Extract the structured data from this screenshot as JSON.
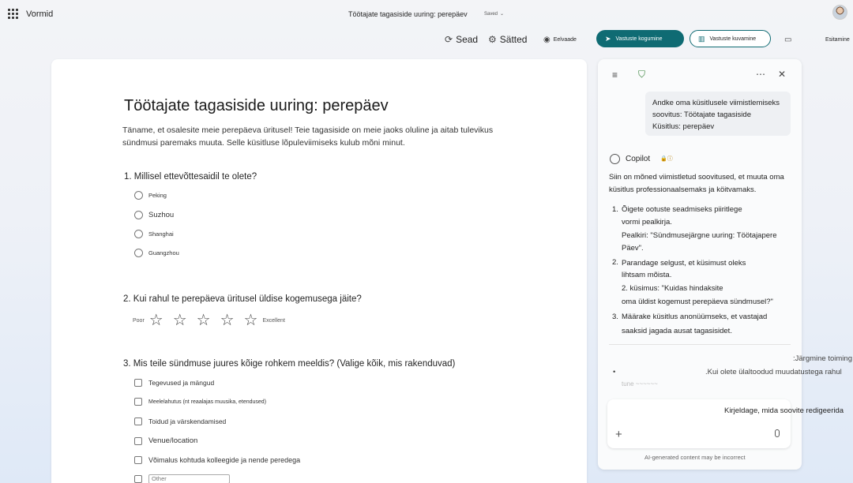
{
  "header": {
    "app_name": "Vormid",
    "doc_title": "Töötajate tagasiside uuring: perepäev",
    "saved_label": "Saved"
  },
  "toolbar": {
    "devices": "Sead",
    "settings": "Sätted",
    "preview": "Eelvaade",
    "collect": "Vastuste kogumine",
    "view_responses": "Vastuste kuvamine",
    "present": "Esitamine"
  },
  "form": {
    "title": "Töötajate tagasiside uuring: perepäev",
    "description": "Täname, et osalesite meie perepäeva üritusel! Teie tagasiside on meie jaoks oluline ja aitab tulevikus sündmusi paremaks muuta. Selle küsitluse lõpuleviimiseks kulub mõni minut.",
    "q1": {
      "label": "1. Millisel ettevõttesaidil te olete?",
      "options": [
        "Peking",
        "Suzhou",
        "Shanghai",
        "Guangzhou"
      ]
    },
    "q2": {
      "number": "2.",
      "label": "Kui rahul te perepäeva üritusel üldise kogemusega jäite?",
      "low": "Poor",
      "high": "Excellent",
      "stars": 5
    },
    "q3": {
      "number": "3.",
      "label": "Mis teile sündmuse juures kõige rohkem meeldis? (Valige kõik, mis rakenduvad)",
      "options": [
        "Tegevused ja mängud",
        "Meelelahutus (nt reaalajas muusika, etendused)",
        "Toidud ja värskendamised",
        "Venue/location",
        "Võimalus kohtuda kolleegide ja nende peredega"
      ],
      "other_placeholder": "Other"
    }
  },
  "copilot": {
    "user_message": [
      "Andke oma küsitlusele viimistlemiseks",
      "soovitus: Töötajate tagasiside",
      "Küsitlus: perepäev"
    ],
    "name": "Copilot",
    "intro": "Siin on mõned viimistletud soovitused, et muuta oma küsitlus professionaalsemaks ja köitvamaks.",
    "items": {
      "n1": "1.",
      "i1_line1": "Õigete ootuste seadmiseks piiritlege",
      "i1_line2": "vormi pealkirja.",
      "i1_line3": "Pealkiri: \"Sündmusejärgne uuring: Töötajapere",
      "i1_line4": "Päev\".",
      "n2": "2.",
      "i2_line1": "Parandage selgust, et küsimust oleks",
      "i2_line2": "lihtsam mõista.",
      "i2_line3": "2. küsimus: \"Kuidas hindaksite",
      "i2_line4": "oma üldist kogemust perepäeva sündmusel?\"",
      "n3": "3.",
      "i3_line1": "Määrake küsitlus anonüümseks, et vastajad",
      "i3_line2": "saaksid jagada ausat tagasisidet."
    },
    "next_steps": ":Järgmine toiming",
    "bullet": "•",
    "bullet_text": ".Kui olete ülaltoodud muudatustega rahul",
    "ghost_text": "tune    ~~~~~~",
    "input_placeholder": "Kirjeldage, mida soovite redigeerida",
    "disclaimer": "AI-generated content may be incorrect"
  }
}
